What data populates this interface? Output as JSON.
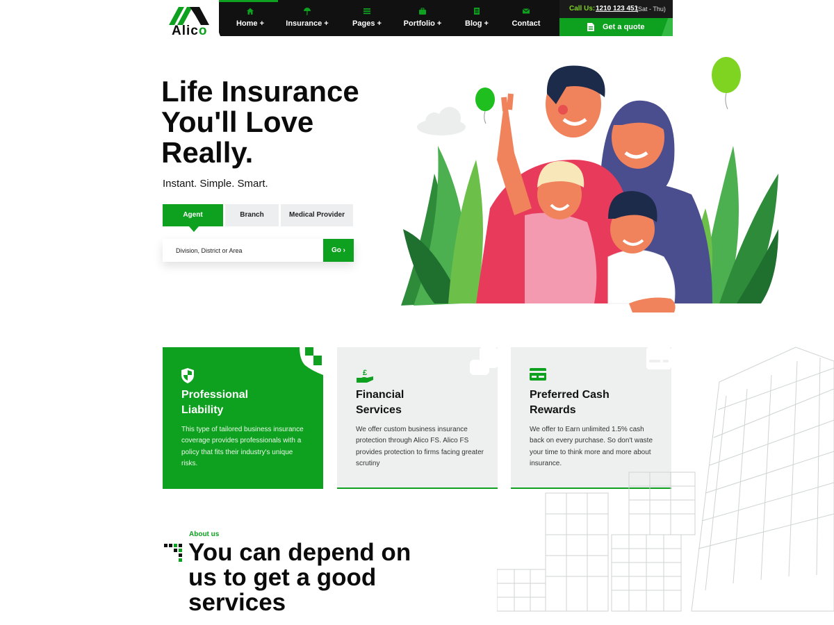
{
  "brand": {
    "name_main": "Alic",
    "name_accent": "o",
    "accent_color": "#0ea01f"
  },
  "nav": {
    "items": [
      {
        "label": "Home +",
        "icon": "home-icon"
      },
      {
        "label": "Insurance +",
        "icon": "umbrella-icon"
      },
      {
        "label": "Pages +",
        "icon": "list-icon"
      },
      {
        "label": "Portfolio +",
        "icon": "briefcase-icon"
      },
      {
        "label": "Blog +",
        "icon": "document-icon"
      },
      {
        "label": "Contact",
        "icon": "envelope-icon"
      }
    ]
  },
  "contact": {
    "call_label": "Call Us:",
    "phone": "1210 123 451",
    "days": "(Sat - Thu)",
    "quote_label": "Get a quote",
    "quote_icon": "file-icon"
  },
  "hero": {
    "title_lines": [
      "Life Insurance",
      "You'll Love",
      "Really."
    ],
    "subtitle": "Instant. Simple. Smart.",
    "tabs": [
      "Agent",
      "Branch",
      "Medical Provider"
    ],
    "active_tab": "Agent",
    "search": {
      "placeholder": "Division, District or Area",
      "value": "",
      "button_label": "Go ›"
    }
  },
  "cards": [
    {
      "title_lines": [
        "Professional",
        "Liability"
      ],
      "text": "This type of tailored business insurance coverage provides professionals with a policy that fits their industry's unique risks.",
      "icon": "shield-icon"
    },
    {
      "title_lines": [
        "Financial",
        "Services"
      ],
      "text": "We offer custom business insurance protection through Alico FS. Alico FS provides protection to firms facing greater scrutiny",
      "icon": "pound-hand-icon"
    },
    {
      "title_lines": [
        "Preferred Cash",
        "Rewards"
      ],
      "text": "We offer to Earn unlimited 1.5% cash back on every purchase. So don't waste your time to think more and more about insurance.",
      "icon": "credit-card-icon"
    }
  ],
  "about": {
    "label": "About us",
    "title_lines": [
      "You can depend on",
      "us to get a good",
      "services"
    ]
  }
}
